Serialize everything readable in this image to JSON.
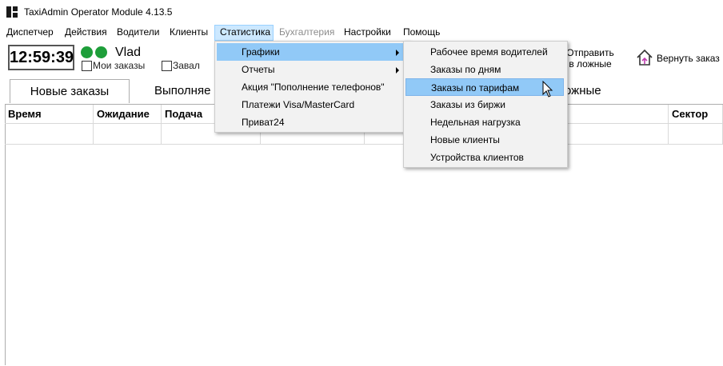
{
  "window": {
    "title": "TaxiAdmin Operator Module 4.13.5"
  },
  "menubar": {
    "items": [
      "Диспетчер",
      "Действия",
      "Водители",
      "Клиенты",
      "Статистика",
      "Бухгалтерия",
      "Настройки",
      "Помощь"
    ],
    "active_item": "Статистика",
    "disabled_item": "Бухгалтерия"
  },
  "toolbar": {
    "clock": "12:59:39",
    "user": "Vlad",
    "status_color": "#1e9e3a",
    "my_orders_label": "Мои заказы",
    "overload_label": "Завал",
    "send_to_false_label": "Отправить в ложные",
    "return_order_label": "Вернуть заказ"
  },
  "tabs": [
    {
      "label": "Новые заказы",
      "selected": true
    },
    {
      "label": "Выполняе",
      "selected": false
    },
    {
      "label": "ожные",
      "selected": false
    }
  ],
  "grid": {
    "columns": [
      "Время",
      "Ожидание",
      "Подача",
      "Сектор"
    ]
  },
  "stats_menu": {
    "items": [
      "Графики",
      "Отчеты",
      "Акция \"Пополнение телефонов\"",
      "Платежи Visa/MasterCard",
      "Приват24"
    ],
    "highlighted": "Графики"
  },
  "charts_submenu": {
    "items": [
      "Рабочее время водителей",
      "Заказы по дням",
      "Заказы по тарифам",
      "Заказы из биржи",
      "Недельная нагрузка",
      "Новые клиенты",
      "Устройства клиентов"
    ],
    "hovered": "Заказы по тарифам"
  },
  "colors": {
    "menu_highlight": "#91c9f7",
    "menubar_active": "#cce8ff"
  }
}
